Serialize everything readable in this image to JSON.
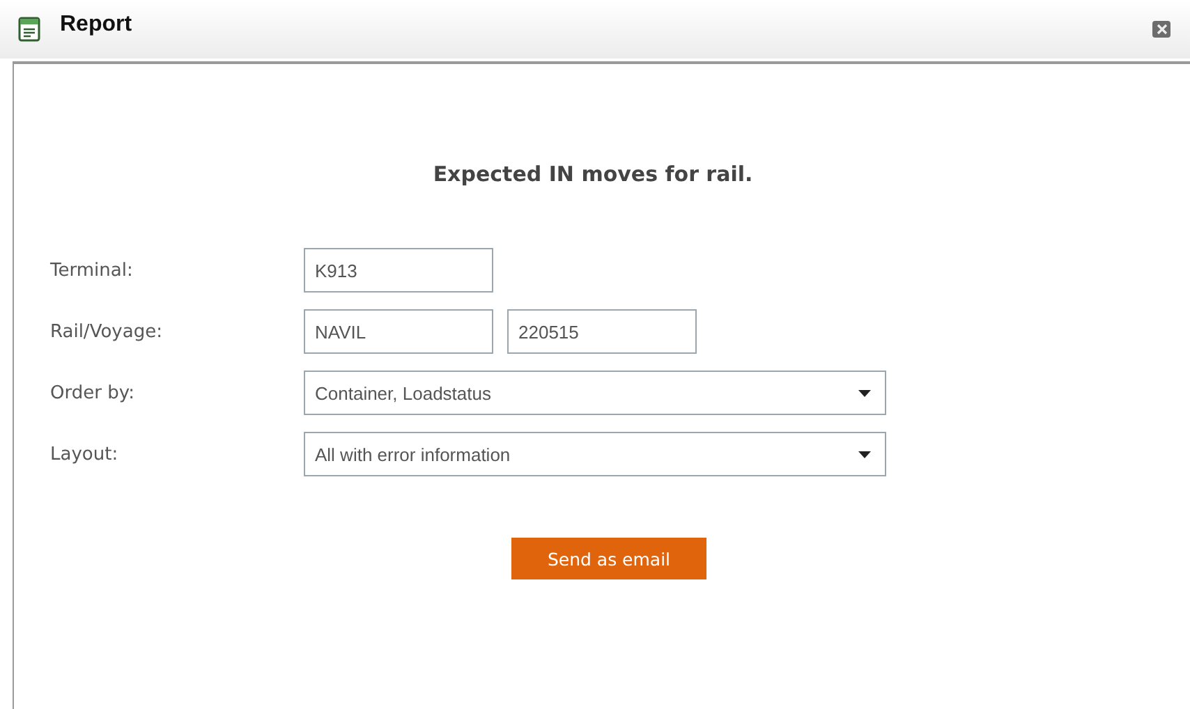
{
  "window": {
    "title": "Report"
  },
  "heading": "Expected IN moves for rail.",
  "fields": [
    {
      "label": "Terminal:",
      "inputs": [
        {
          "kind": "text",
          "value": "K913"
        }
      ]
    },
    {
      "label": "Rail/Voyage:",
      "inputs": [
        {
          "kind": "text",
          "value": "NAVIL"
        },
        {
          "kind": "text",
          "value": "220515"
        }
      ]
    },
    {
      "label": "Order by:",
      "inputs": [
        {
          "kind": "select",
          "value": "Container, Loadstatus"
        }
      ]
    },
    {
      "label": "Layout:",
      "inputs": [
        {
          "kind": "select",
          "value": "All with error information"
        }
      ]
    }
  ],
  "button": "Send as email"
}
